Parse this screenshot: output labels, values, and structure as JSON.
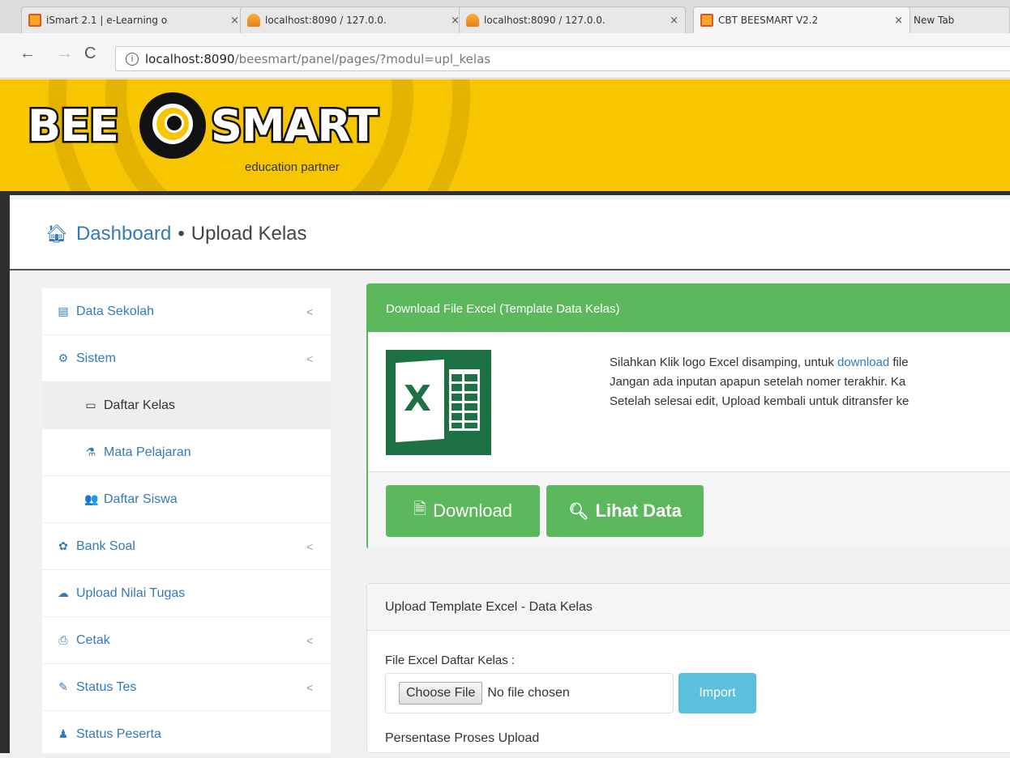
{
  "browser": {
    "tabs": [
      {
        "label": "iSmart 2.1 | e-Learning o",
        "icon": "beesmart-favicon"
      },
      {
        "label": "localhost:8090 / 127.0.0.",
        "icon": "phpmyadmin-favicon"
      },
      {
        "label": "localhost:8090 / 127.0.0.",
        "icon": "phpmyadmin-favicon"
      },
      {
        "label": "CBT BEESMART V2.2",
        "icon": "beesmart-favicon"
      },
      {
        "label": "New Tab",
        "icon": ""
      }
    ],
    "close_glyph": "×",
    "url_host": "localhost:8090",
    "url_path": "/beesmart/panel/pages/?modul=upl_kelas"
  },
  "header": {
    "logo_left": "BEE",
    "logo_right": "SMART",
    "tagline": "education partner",
    "brand_color": "#f7c600"
  },
  "page": {
    "breadcrumb_home": "Dashboard",
    "separator": "•",
    "title": "Upload Kelas"
  },
  "sidebar": {
    "items": [
      {
        "label": "Data Sekolah",
        "icon": "building-icon",
        "glyph": "▤",
        "chevron": true
      },
      {
        "label": "Sistem",
        "icon": "cogs-icon",
        "glyph": "⚙",
        "chevron": true
      },
      {
        "label": "Daftar Kelas",
        "icon": "list-icon",
        "glyph": "▭",
        "sub": true,
        "active": true
      },
      {
        "label": "Mata Pelajaran",
        "icon": "flask-icon",
        "glyph": "⚗",
        "sub": true
      },
      {
        "label": "Daftar Siswa",
        "icon": "users-icon",
        "glyph": "👥",
        "sub": true
      },
      {
        "label": "Bank Soal",
        "icon": "gear-icon",
        "glyph": "✿",
        "chevron": true
      },
      {
        "label": "Upload Nilai Tugas",
        "icon": "cloud-upload-icon",
        "glyph": "☁"
      },
      {
        "label": "Cetak",
        "icon": "print-icon",
        "glyph": "⎙",
        "chevron": true
      },
      {
        "label": "Status Tes",
        "icon": "edit-icon",
        "glyph": "✎",
        "chevron": true
      },
      {
        "label": "Status Peserta",
        "icon": "user-icon",
        "glyph": "♟"
      }
    ],
    "chevron_glyph": "<"
  },
  "download_panel": {
    "heading": "Download File Excel (Template Data Kelas)",
    "line1_pre": "Silahkan Klik logo Excel disamping, untuk ",
    "line1_link": "download",
    "line1_post": " file",
    "line2": "Jangan ada inputan apapun setelah nomer terakhir. Ka",
    "line3": "Setelah selesai edit, Upload kembali untuk ditransfer ke",
    "download_label": "Download",
    "view_label": "Lihat Data",
    "excel_letter": "X"
  },
  "upload_panel": {
    "heading": "Upload Template Excel - Data Kelas",
    "file_label": "File Excel Daftar Kelas :",
    "choose_label": "Choose File",
    "no_file": "No file chosen",
    "import_label": "Import",
    "progress_label": "Persentase Proses Upload"
  }
}
